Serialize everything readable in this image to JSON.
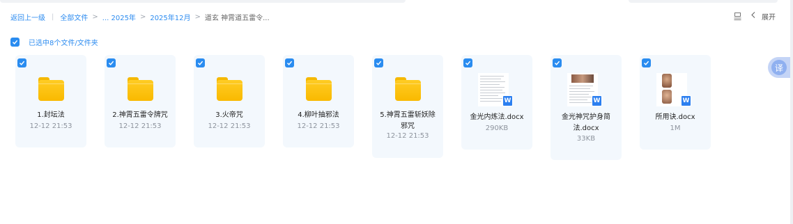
{
  "breadcrumb": {
    "back": "返回上一级",
    "items": [
      "全部文件",
      "... 2025年",
      "2025年12月"
    ],
    "current": "道玄 神霄道五雷令..."
  },
  "toolbar": {
    "expand_label": "展开"
  },
  "selection": {
    "text": "已选中8个文件/文件夹"
  },
  "translate": {
    "label": "译"
  },
  "files": [
    {
      "type": "folder",
      "name": "1.封坛法",
      "date": "12-12 21:53",
      "selected": true
    },
    {
      "type": "folder",
      "name": "2.神霄五雷令牌咒",
      "date": "12-12 21:53",
      "selected": true
    },
    {
      "type": "folder",
      "name": "3.火帝咒",
      "date": "12-12 21:53",
      "selected": true
    },
    {
      "type": "folder",
      "name": "4.柳叶抽邪法",
      "date": "12-12 21:53",
      "selected": true
    },
    {
      "type": "folder",
      "name": "5.神霄五雷斩妖除邪咒",
      "date": "12-12 21:53",
      "selected": true
    },
    {
      "type": "docx",
      "name": "金光内炼法.docx",
      "size": "290KB",
      "selected": true
    },
    {
      "type": "docx",
      "name": "金光神咒护身简法.docx",
      "size": "33KB",
      "selected": true
    },
    {
      "type": "docx",
      "name": "所用诀.docx",
      "size": "1M",
      "selected": true
    }
  ],
  "icons": {
    "docx_badge": "W",
    "check": "check-icon",
    "folder": "folder-icon"
  },
  "colors": {
    "accent": "#2a8cf0",
    "card_bg": "#f3f8fd",
    "folder": "#ffcc24"
  }
}
